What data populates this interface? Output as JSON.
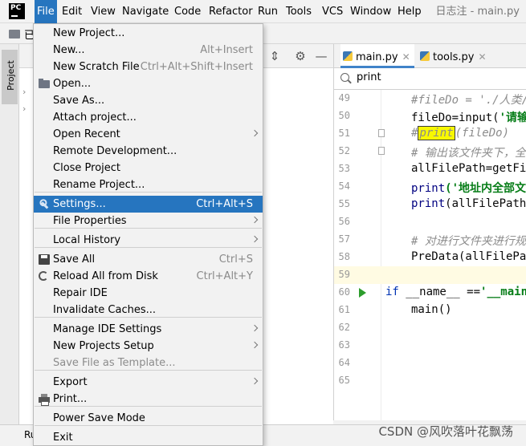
{
  "menubar": {
    "logo_text": "PC",
    "items": [
      "File",
      "Edit",
      "View",
      "Navigate",
      "Code",
      "Refactor",
      "Run",
      "Tools",
      "VCS",
      "Window",
      "Help"
    ],
    "window_title": "日志注 - main.py"
  },
  "navbar": {
    "text": "已"
  },
  "sidebar": {
    "project_tab": "Project"
  },
  "bottom": {
    "text": "Ru"
  },
  "editor": {
    "tabs": [
      {
        "label": "main.py",
        "active": true
      },
      {
        "label": "tools.py",
        "active": false
      }
    ],
    "search_value": "print",
    "lines": [
      {
        "num": "49",
        "code": "#fileDo = './人类/人"
      },
      {
        "num": "50",
        "code": "fileDo=input('请输入"
      },
      {
        "num": "51",
        "code": "#print(fileDo)"
      },
      {
        "num": "52",
        "code": "# 输出该文件夹下，全部"
      },
      {
        "num": "53",
        "code": "allFilePath=getFil"
      },
      {
        "num": "54",
        "code": "print('地址内全部文件"
      },
      {
        "num": "55",
        "code": "print(allFilePath)"
      },
      {
        "num": "56",
        "code": ""
      },
      {
        "num": "57",
        "code": "# 对进行文件夹进行规范"
      },
      {
        "num": "58",
        "code": "PreData(allFilePat"
      },
      {
        "num": "59",
        "code": ""
      },
      {
        "num": "60",
        "code": "if __name__ =='__main_"
      },
      {
        "num": "61",
        "code": "main()"
      },
      {
        "num": "62",
        "code": ""
      },
      {
        "num": "63",
        "code": ""
      },
      {
        "num": "64",
        "code": ""
      },
      {
        "num": "65",
        "code": ""
      }
    ]
  },
  "watermark": "CSDN @风吹落叶花飘荡",
  "file_menu": {
    "items": [
      {
        "label": "New Project...",
        "shortcut": "",
        "submenu": false
      },
      {
        "label": "New...",
        "shortcut": "Alt+Insert",
        "submenu": false
      },
      {
        "label": "New Scratch File",
        "shortcut": "Ctrl+Alt+Shift+Insert",
        "submenu": false
      },
      {
        "label": "Open...",
        "shortcut": "",
        "submenu": false,
        "icon": "folder-icon"
      },
      {
        "label": "Save As...",
        "shortcut": "",
        "submenu": false
      },
      {
        "label": "Attach project...",
        "shortcut": "",
        "submenu": false
      },
      {
        "label": "Open Recent",
        "shortcut": "",
        "submenu": true
      },
      {
        "label": "Remote Development...",
        "shortcut": "",
        "submenu": false
      },
      {
        "label": "Close Project",
        "shortcut": "",
        "submenu": false
      },
      {
        "label": "Rename Project...",
        "shortcut": "",
        "submenu": false
      },
      {
        "label": "Settings...",
        "shortcut": "Ctrl+Alt+S",
        "submenu": false,
        "icon": "wrench-icon",
        "selected": true
      },
      {
        "label": "File Properties",
        "shortcut": "",
        "submenu": true
      },
      {
        "label": "Local History",
        "shortcut": "",
        "submenu": true
      },
      {
        "label": "Save All",
        "shortcut": "Ctrl+S",
        "submenu": false,
        "icon": "save-icon"
      },
      {
        "label": "Reload All from Disk",
        "shortcut": "Ctrl+Alt+Y",
        "submenu": false,
        "icon": "reload-icon"
      },
      {
        "label": "Repair IDE",
        "shortcut": "",
        "submenu": false
      },
      {
        "label": "Invalidate Caches...",
        "shortcut": "",
        "submenu": false
      },
      {
        "label": "Manage IDE Settings",
        "shortcut": "",
        "submenu": true
      },
      {
        "label": "New Projects Setup",
        "shortcut": "",
        "submenu": true
      },
      {
        "label": "Save File as Template...",
        "shortcut": "",
        "submenu": false,
        "disabled": true
      },
      {
        "label": "Export",
        "shortcut": "",
        "submenu": true
      },
      {
        "label": "Print...",
        "shortcut": "",
        "submenu": false,
        "icon": "print-icon"
      },
      {
        "label": "Power Save Mode",
        "shortcut": "",
        "submenu": false
      },
      {
        "label": "Exit",
        "shortcut": "",
        "submenu": false
      }
    ]
  },
  "colors": {
    "accent": "#2675bf",
    "menu_bg": "#f2f2f2",
    "highlight": "#f8f800"
  }
}
